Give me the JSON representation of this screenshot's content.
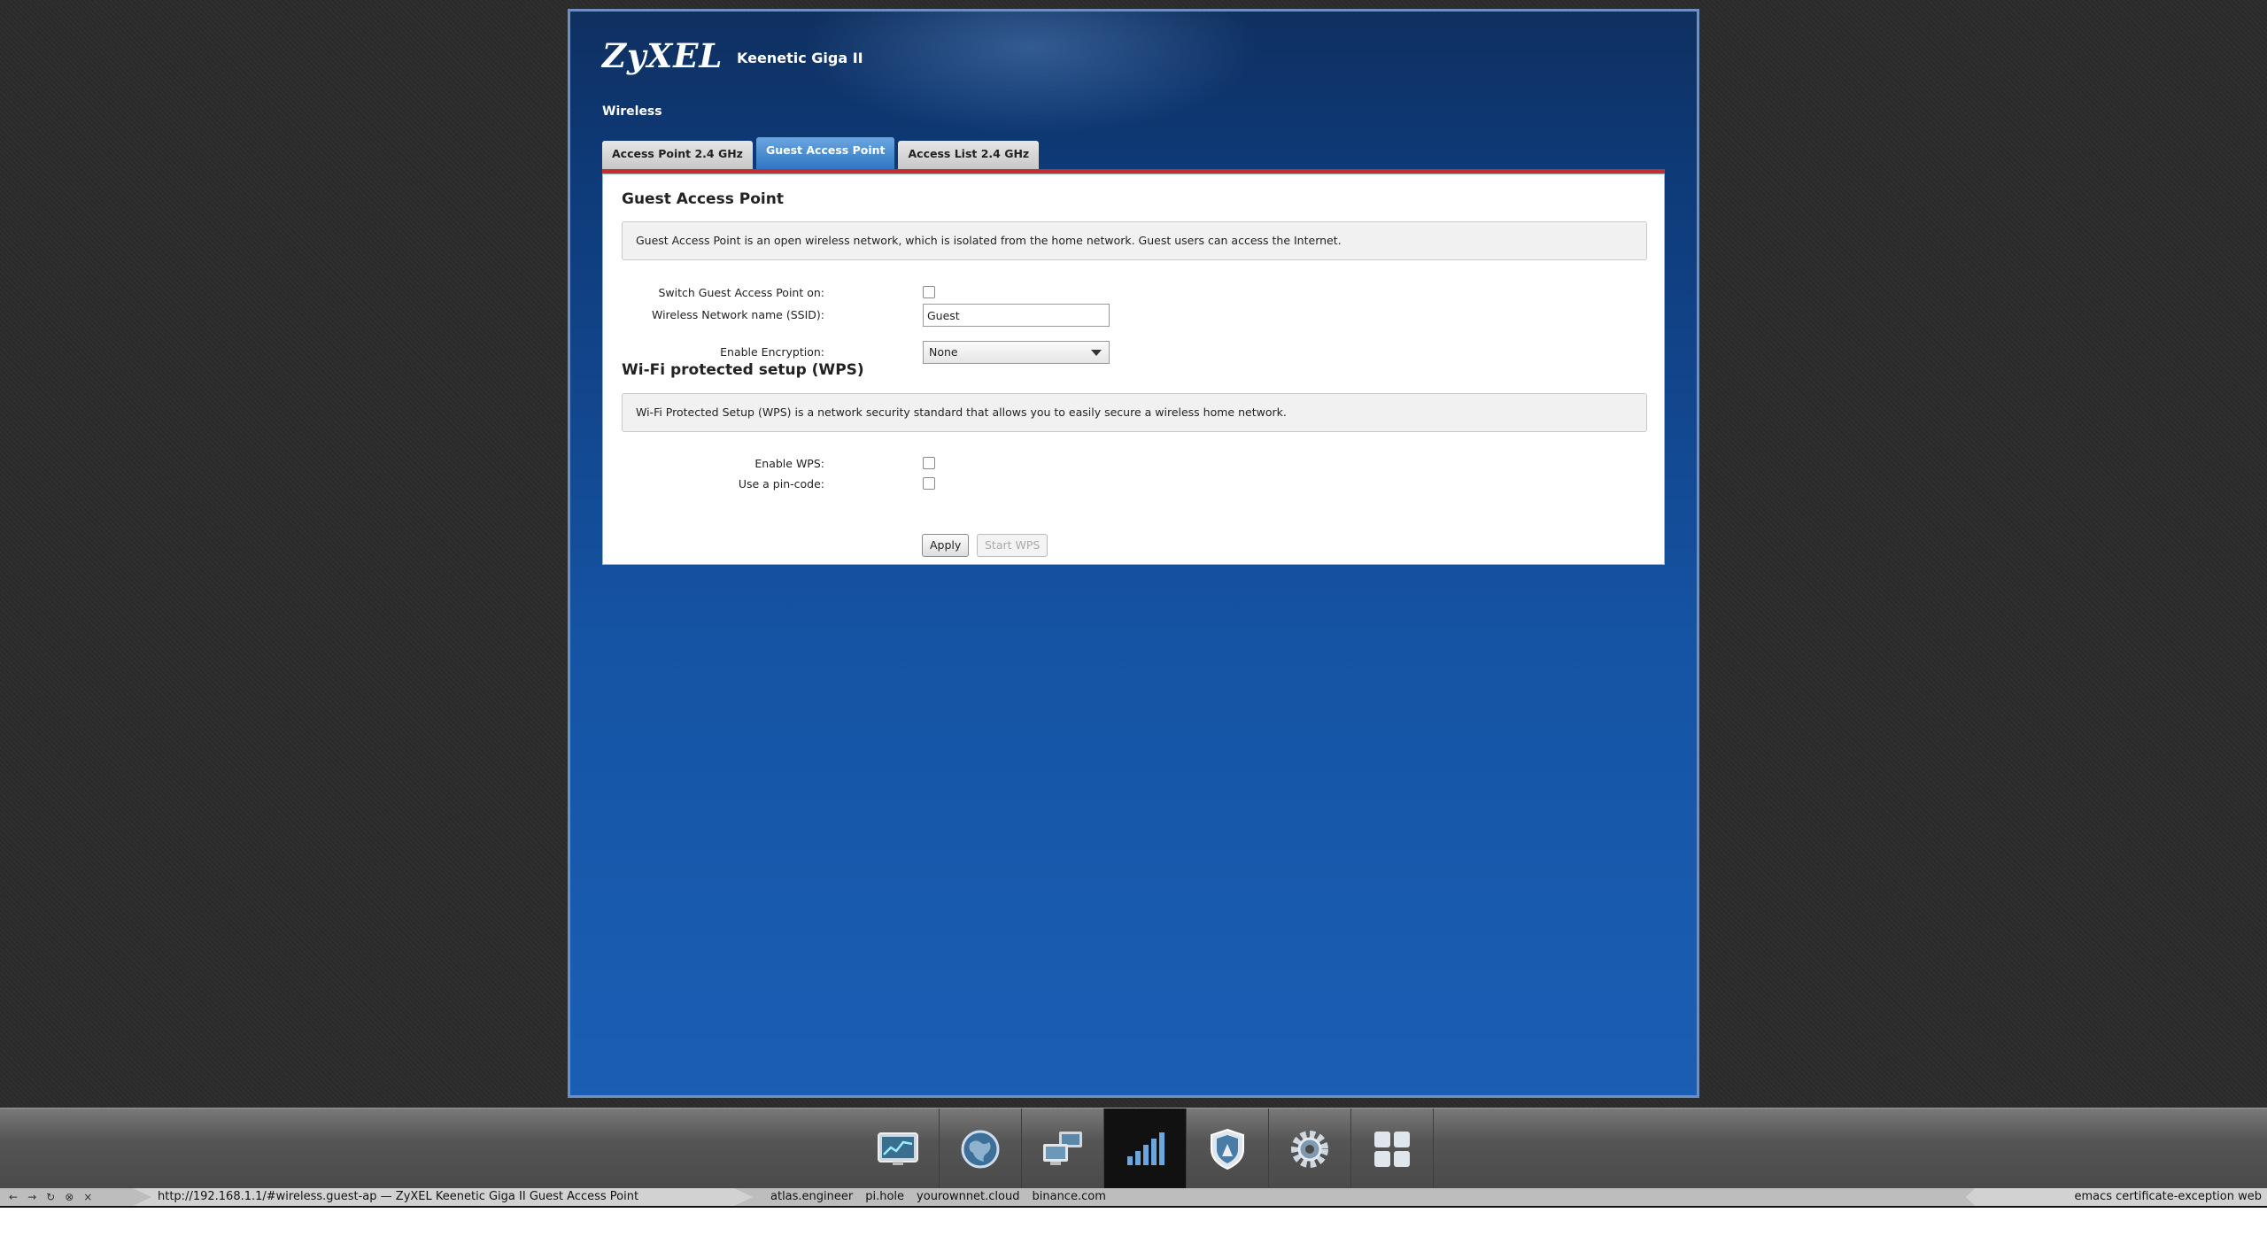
{
  "header": {
    "logo": "ZyXEL",
    "model": "Keenetic Giga II",
    "section": "Wireless"
  },
  "tabs": [
    {
      "label": "Access Point 2.4 GHz",
      "active": false
    },
    {
      "label": "Guest Access Point",
      "active": true
    },
    {
      "label": "Access List 2.4 GHz",
      "active": false
    }
  ],
  "guest": {
    "title": "Guest Access Point",
    "info": "Guest Access Point is an open wireless network, which is isolated from the home network. Guest users can access the Internet.",
    "switch_label": "Switch Guest Access Point on:",
    "switch_checked": false,
    "ssid_label": "Wireless Network name (SSID):",
    "ssid_value": "Guest",
    "encryption_label": "Enable Encryption:",
    "encryption_value": "None"
  },
  "wps": {
    "title": "Wi-Fi protected setup (WPS)",
    "info": "Wi-Fi Protected Setup (WPS) is a network security standard that allows you to easily secure a wireless home network.",
    "enable_label": "Enable WPS:",
    "enable_checked": false,
    "pin_label": "Use a pin-code:",
    "pin_checked": false
  },
  "buttons": {
    "apply": "Apply",
    "start_wps": "Start WPS"
  },
  "dock": {
    "items": [
      {
        "icon": "monitor-chart-icon",
        "active": false
      },
      {
        "icon": "globe-icon",
        "active": false
      },
      {
        "icon": "network-computers-icon",
        "active": false
      },
      {
        "icon": "wifi-signal-bars-icon",
        "active": true
      },
      {
        "icon": "shield-icon",
        "active": false
      },
      {
        "icon": "gear-icon",
        "active": false
      },
      {
        "icon": "apps-grid-icon",
        "active": false
      }
    ]
  },
  "statusbar": {
    "nav": [
      "←",
      "→",
      "↻",
      "⊗",
      "×"
    ],
    "url_title": "http://192.168.1.1/#wireless.guest-ap — ZyXEL Keenetic Giga II Guest Access Point",
    "bookmarks": [
      "atlas.engineer",
      "pi.hole",
      "yourownnet.cloud",
      "binance.com"
    ],
    "right": "emacs certificate-exception web"
  },
  "colors": {
    "accent_red": "#c62d2d",
    "active_tab": "#2f78c4",
    "frame_blue": "#1553a3"
  }
}
